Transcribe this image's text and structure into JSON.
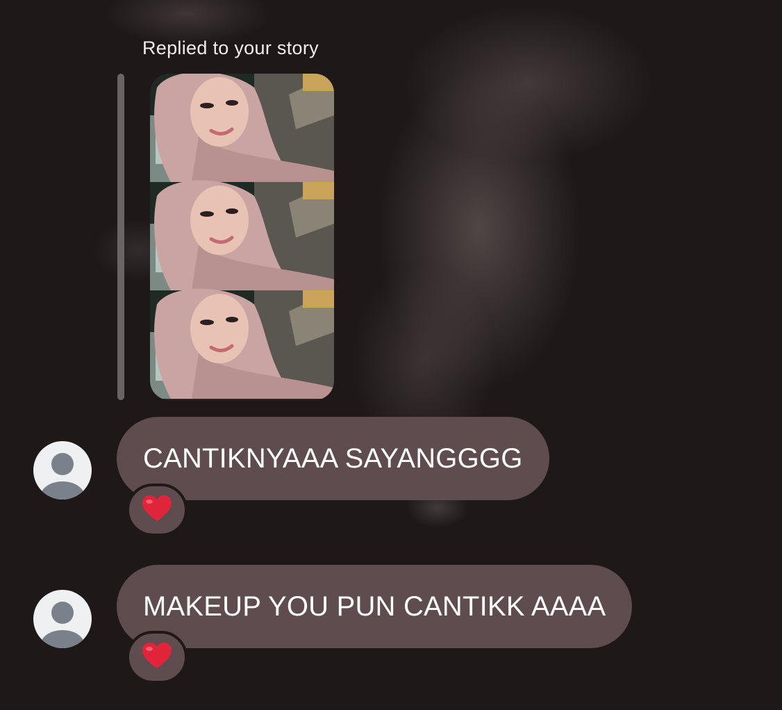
{
  "story_reply": {
    "caption": "Replied to your story"
  },
  "messages": [
    {
      "text": "CANTIKNYAAA SAYANGGGG",
      "reaction": "heart-emoji"
    },
    {
      "text": "MAKEUP YOU PUN CANTIKK AAAA",
      "reaction": "heart-emoji"
    }
  ],
  "colors": {
    "background": "#1e1818",
    "bubble": "#5e4c4e",
    "reply_bar": "#6a6464",
    "heart": "#e0243a"
  }
}
